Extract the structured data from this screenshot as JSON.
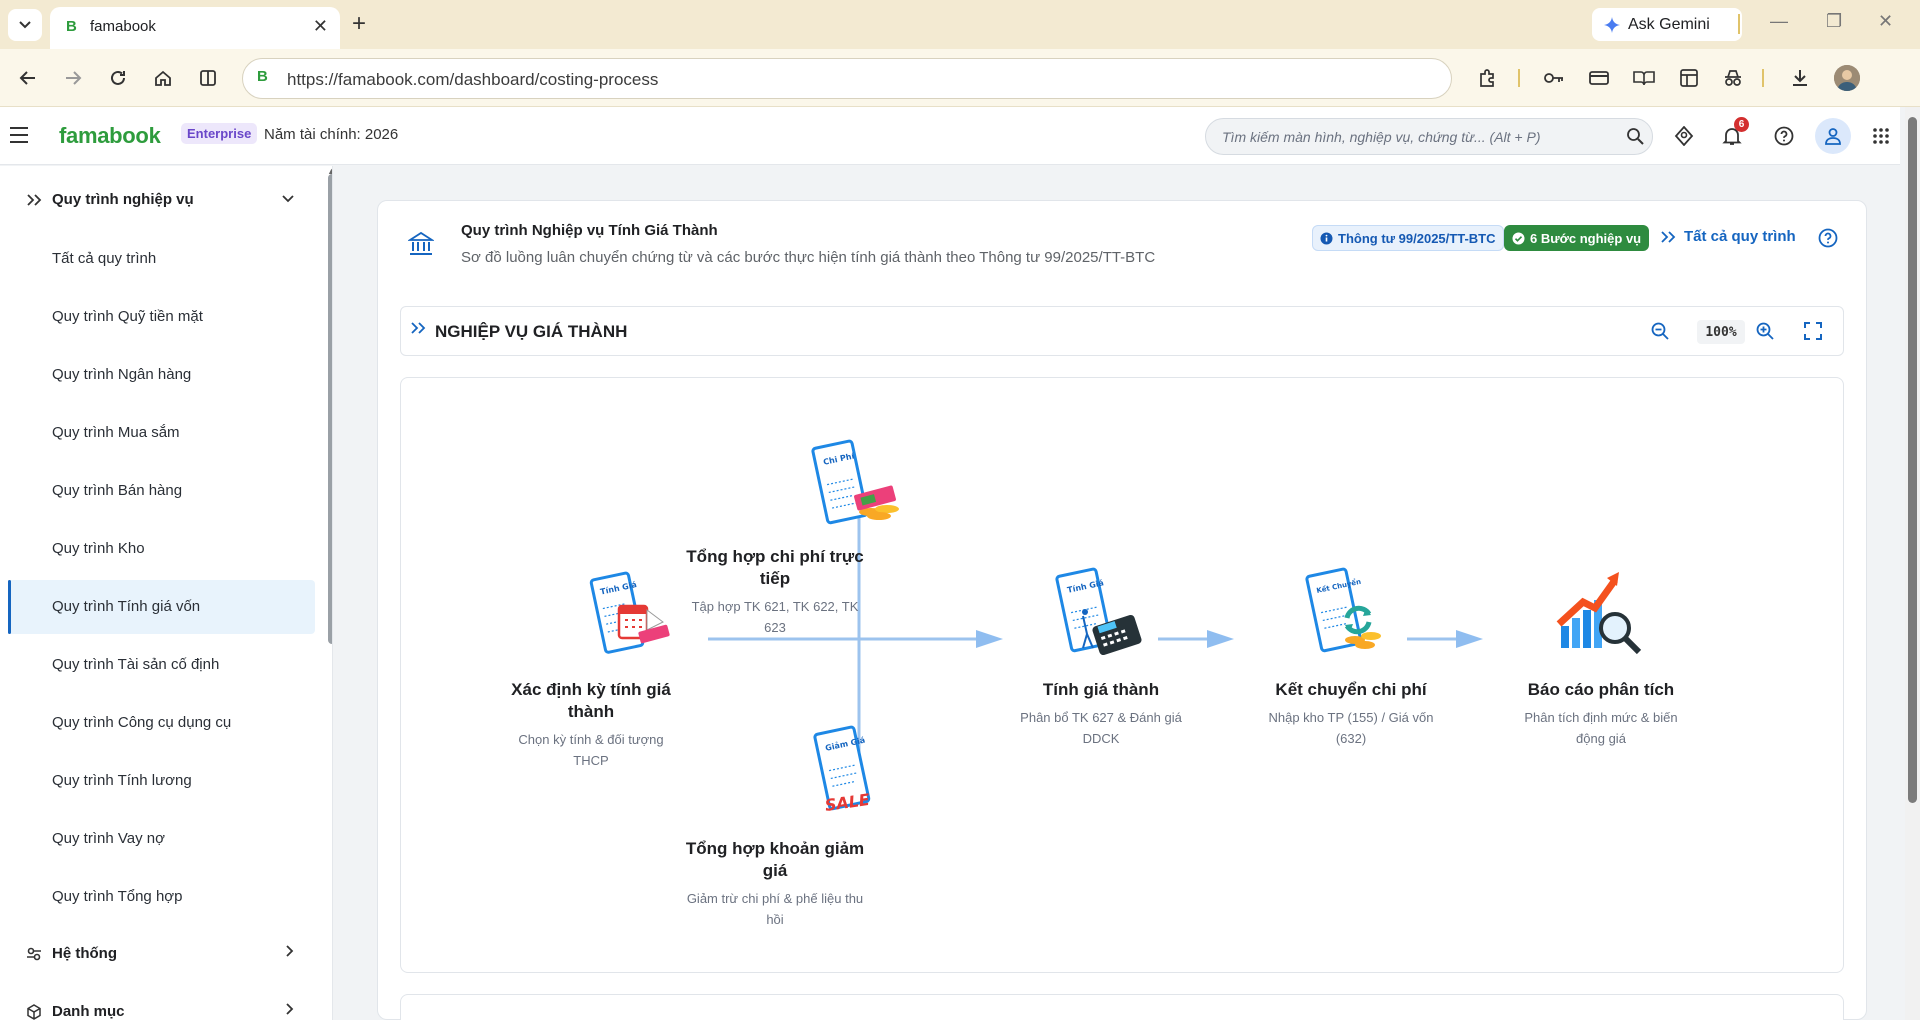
{
  "browser": {
    "tab_title": "famabook",
    "url": "https://famabook.com/dashboard/costing-process",
    "gemini_label": "Ask Gemini"
  },
  "header": {
    "logo": "famabook",
    "plan_badge": "Enterprise",
    "fiscal_year": "Năm tài chính: 2026",
    "search_placeholder": "Tìm kiếm màn hình, nghiệp vụ, chứng từ... (Alt + P)",
    "notification_count": "6"
  },
  "sidebar": {
    "group_main": "Quy trình nghiệp vụ",
    "items": [
      {
        "label": "Tất cả quy trình"
      },
      {
        "label": "Quy trình Quỹ tiền mặt"
      },
      {
        "label": "Quy trình Ngân hàng"
      },
      {
        "label": "Quy trình Mua sắm"
      },
      {
        "label": "Quy trình Bán hàng"
      },
      {
        "label": "Quy trình Kho"
      },
      {
        "label": "Quy trình Tính giá vốn"
      },
      {
        "label": "Quy trình Tài sản cố định"
      },
      {
        "label": "Quy trình Công cụ dụng cụ"
      },
      {
        "label": "Quy trình Tính lương"
      },
      {
        "label": "Quy trình Vay nợ"
      },
      {
        "label": "Quy trình Tổng hợp"
      }
    ],
    "active_index": 6,
    "group_system": "Hệ thống",
    "group_catalog": "Danh mục"
  },
  "page": {
    "title": "Quy trình Nghiệp vụ Tính Giá Thành",
    "subtitle": "Sơ đồ luồng luân chuyển chứng từ và các bước thực hiện tính giá thành theo Thông tư 99/2025/TT-BTC",
    "badge_circular": "Thông tư 99/2025/TT-BTC",
    "badge_steps": "6 Bước nghiệp vụ",
    "all_processes_link": "Tất cả quy trình"
  },
  "section": {
    "title": "NGHIỆP VỤ GIÁ THÀNH",
    "zoom_level": "100%"
  },
  "diagram": {
    "nodes": [
      {
        "title": "Xác định kỳ tính giá thành",
        "desc": "Chọn kỳ tính & đối tượng THCP",
        "doc_label": "Tính Giá"
      },
      {
        "title": "Tổng hợp chi phí trực tiếp",
        "desc": "Tập hợp TK 621, TK 622, TK 623",
        "doc_label": "Chi Phí"
      },
      {
        "title": "Tổng hợp khoản giảm giá",
        "desc": "Giảm trừ chi phí & phế liệu thu hồi",
        "doc_label": "Giảm Giá",
        "sale_label": "SALE"
      },
      {
        "title": "Tính giá thành",
        "desc": "Phân bổ TK 627 & Đánh giá DDCK",
        "doc_label": "Tính Giá"
      },
      {
        "title": "Kết chuyển chi phí",
        "desc": "Nhập kho TP (155) / Giá vốn (632)",
        "doc_label": "Kết Chuyển"
      },
      {
        "title": "Báo cáo phân tích",
        "desc": "Phân tích định mức & biến động giá"
      }
    ]
  },
  "colors": {
    "brand_green": "#2e9c3d",
    "primary_blue": "#1565c0",
    "active_bg": "#e8f3fc",
    "arrow_blue": "#8fbdf0"
  }
}
